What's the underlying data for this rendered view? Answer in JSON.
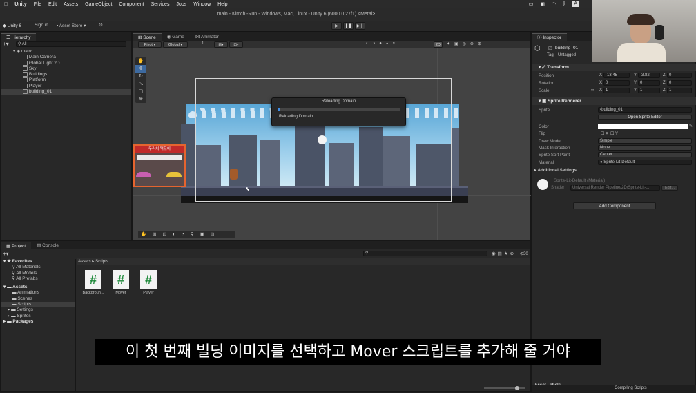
{
  "menu": {
    "apple": "",
    "items": [
      "Unity",
      "File",
      "Edit",
      "Assets",
      "GameObject",
      "Component",
      "Services",
      "Jobs",
      "Window",
      "Help"
    ]
  },
  "window_title": "main - Kimchi-Run - Windows, Mac, Linux - Unity 6 (6000.0.27f1) <Metal>",
  "toolbar": {
    "account": "Unity 6",
    "signin": "Sign in",
    "asset_store": "Asset Store"
  },
  "hierarchy": {
    "tab": "Hierarchy",
    "search_placeholder": "All",
    "scene": "main*",
    "items": [
      "Main Camera",
      "Global Light 2D",
      "Sky",
      "Buildings",
      "Platform",
      "Player",
      "building_01"
    ]
  },
  "scene": {
    "tabs": [
      "Scene",
      "Game",
      "Animator"
    ],
    "pivot": "Pivot",
    "global": "Global",
    "number": "1",
    "mode2d": "2D"
  },
  "progress_dialog": {
    "title": "Reloading Domain",
    "label": "Reloading Domain"
  },
  "inspector": {
    "tab": "Inspector",
    "object_name": "building_01",
    "tag_label": "Tag",
    "tag_value": "Untagged",
    "transform": {
      "title": "Transform",
      "position": {
        "label": "Position",
        "x": "-13.45",
        "y": "-3.82",
        "z": "0"
      },
      "rotation": {
        "label": "Rotation",
        "x": "0",
        "y": "0",
        "z": "0"
      },
      "scale": {
        "label": "Scale",
        "x": "1",
        "y": "1",
        "z": "1"
      }
    },
    "sprite_renderer": {
      "title": "Sprite Renderer",
      "sprite_label": "Sprite",
      "sprite_value": "building_01",
      "open_editor": "Open Sprite Editor",
      "color_label": "Color",
      "flip_label": "Flip",
      "flip_x": "X",
      "flip_y": "Y",
      "draw_mode_label": "Draw Mode",
      "draw_mode": "Simple",
      "mask_label": "Mask Interaction",
      "mask": "None",
      "sort_label": "Sprite Sort Point",
      "sort": "Center",
      "material_label": "Material",
      "material": "Sprite-Lit-Default",
      "additional": "Additional Settings"
    },
    "material": {
      "name": "Sprite-Lit-Default (Material)",
      "shader_label": "Shader",
      "shader": "Universal Render Pipeline/2D/Sprite-Lit-...",
      "edit": "Edit..."
    },
    "add_component": "Add Component",
    "asset_labels": "Asset Labels",
    "status": "Compiling Scripts"
  },
  "project": {
    "tabs": [
      "Project",
      "Console"
    ],
    "favorites": "Favorites",
    "fav_items": [
      "All Materials",
      "All Models",
      "All Prefabs"
    ],
    "assets": "Assets",
    "asset_folders": [
      "Animations",
      "Scenes",
      "Scripts",
      "Settings",
      "Sprites"
    ],
    "packages": "Packages",
    "breadcrumb": [
      "Assets",
      "Scripts"
    ],
    "files": [
      "Backgroun...",
      "Mover",
      "Player"
    ],
    "count": "30"
  },
  "subtitle": "이 첫 번째 빌딩 이미지를 선택하고 Mover 스크립트를 추가해 줄 거야",
  "store_sign": "두리치 떡볶이"
}
